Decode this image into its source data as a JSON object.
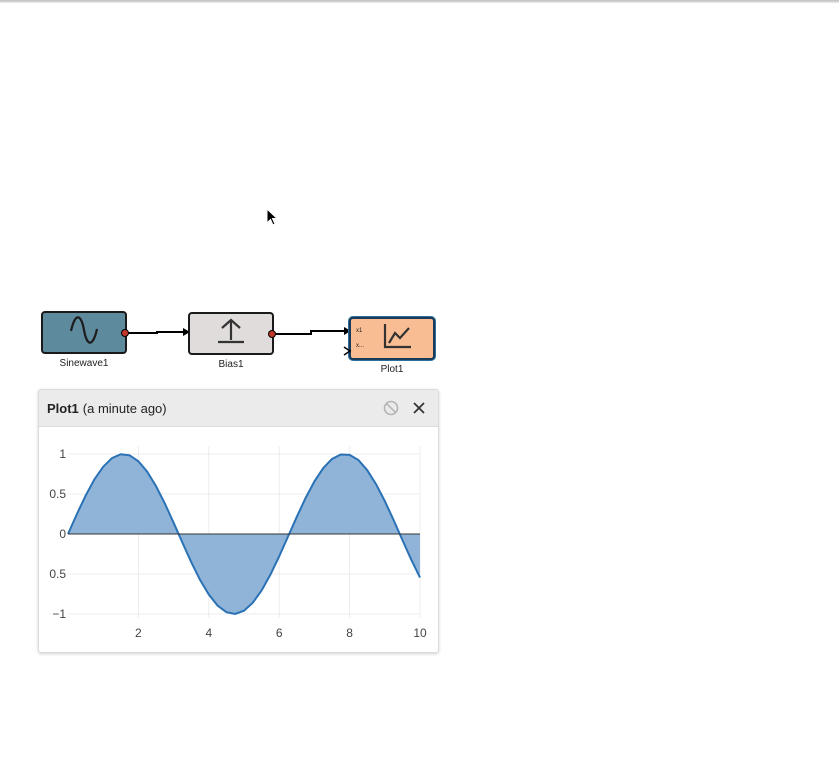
{
  "blocks": {
    "sinewave": {
      "label": "Sinewave1",
      "icon": "sine-wave-icon",
      "color": "#5e8a9e"
    },
    "bias": {
      "label": "Bias1",
      "icon": "bias-arrow-icon",
      "color": "#e0dcdc"
    },
    "plot": {
      "label": "Plot1",
      "icon": "line-chart-icon",
      "color": "#f9bd94",
      "port_labels": [
        "x1",
        "x..."
      ]
    }
  },
  "panel": {
    "title": "Plot1",
    "subtitle": "(a minute ago)",
    "disable_icon": "disable-icon",
    "close_icon": "close-icon"
  },
  "chart_data": {
    "type": "area",
    "title": "",
    "xlabel": "",
    "ylabel": "",
    "xlim": [
      0,
      10
    ],
    "ylim": [
      -1,
      1
    ],
    "x_ticks": [
      2,
      4,
      6,
      8,
      10
    ],
    "x_tick_labels": [
      "2",
      "4",
      "6",
      "8",
      "10"
    ],
    "y_ticks": [
      1,
      0.5,
      0,
      -0.5,
      -1
    ],
    "y_tick_labels": [
      "1",
      "0.5",
      "0",
      "0.5",
      "−1"
    ],
    "grid": true,
    "series": [
      {
        "fill_color": "#8fb4d8",
        "line_color": "#2a72b5",
        "x": [
          0,
          0.25,
          0.5,
          0.75,
          1,
          1.25,
          1.5,
          1.75,
          2,
          2.25,
          2.5,
          2.75,
          3,
          3.25,
          3.5,
          3.75,
          4,
          4.25,
          4.5,
          4.75,
          5,
          5.25,
          5.5,
          5.75,
          6,
          6.25,
          6.5,
          6.75,
          7,
          7.25,
          7.5,
          7.75,
          8,
          8.25,
          8.5,
          8.75,
          9,
          9.25,
          9.5,
          9.75,
          10
        ],
        "y": [
          0,
          0.247,
          0.479,
          0.682,
          0.841,
          0.949,
          0.997,
          0.984,
          0.909,
          0.778,
          0.598,
          0.382,
          0.141,
          -0.108,
          -0.351,
          -0.572,
          -0.757,
          -0.895,
          -0.978,
          -0.999,
          -0.959,
          -0.859,
          -0.706,
          -0.508,
          -0.279,
          -0.033,
          0.215,
          0.45,
          0.657,
          0.823,
          0.938,
          0.994,
          0.989,
          0.925,
          0.798,
          0.624,
          0.412,
          0.174,
          -0.075,
          -0.319,
          -0.544
        ]
      }
    ]
  }
}
